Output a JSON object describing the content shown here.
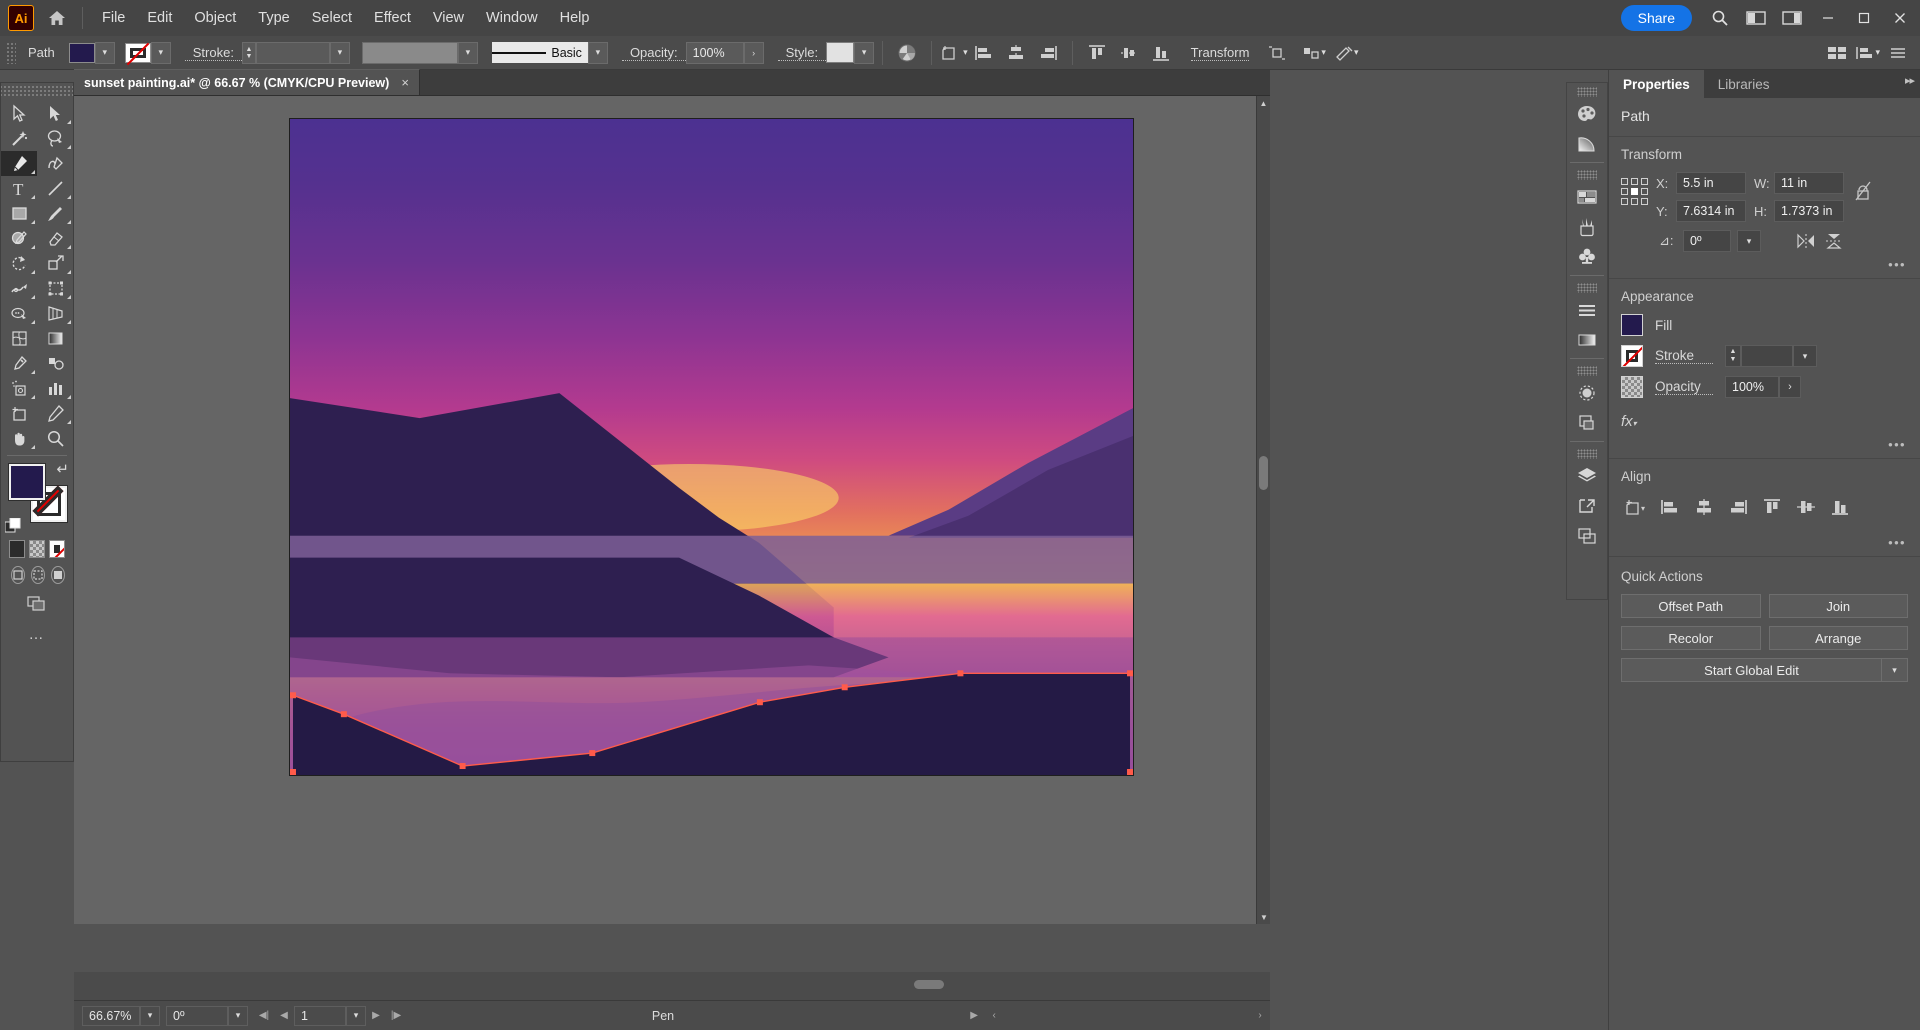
{
  "app": {
    "logo_text": "Ai",
    "menus": [
      "File",
      "Edit",
      "Object",
      "Type",
      "Select",
      "Effect",
      "View",
      "Window",
      "Help"
    ],
    "share_label": "Share",
    "accent_color": "#1473e6",
    "window_buttons": [
      "minimize",
      "maximize",
      "close"
    ]
  },
  "control_bar": {
    "object_label": "Path",
    "stroke_label": "Stroke:",
    "stroke_weight": "",
    "profile_value": "",
    "brush_label": "Basic",
    "opacity_label": "Opacity:",
    "opacity_value": "100%",
    "style_label": "Style:",
    "transform_label": "Transform",
    "fill_color": "#231a4d",
    "stroke_color": "none"
  },
  "toolbar": {
    "tools": [
      {
        "name": "selection-tool",
        "active": false
      },
      {
        "name": "direct-selection-tool",
        "active": false
      },
      {
        "name": "magic-wand-tool",
        "active": false
      },
      {
        "name": "lasso-tool",
        "active": false
      },
      {
        "name": "pen-tool",
        "active": true
      },
      {
        "name": "curvature-tool",
        "active": false
      },
      {
        "name": "type-tool",
        "active": false
      },
      {
        "name": "line-segment-tool",
        "active": false
      },
      {
        "name": "rectangle-tool",
        "active": false
      },
      {
        "name": "paintbrush-tool",
        "active": false
      },
      {
        "name": "shaper-tool",
        "active": false
      },
      {
        "name": "eraser-tool",
        "active": false
      },
      {
        "name": "rotate-tool",
        "active": false
      },
      {
        "name": "scale-tool",
        "active": false
      },
      {
        "name": "width-tool",
        "active": false
      },
      {
        "name": "free-transform-tool",
        "active": false
      },
      {
        "name": "shape-builder-tool",
        "active": false
      },
      {
        "name": "perspective-grid-tool",
        "active": false
      },
      {
        "name": "mesh-tool",
        "active": false
      },
      {
        "name": "gradient-tool",
        "active": false
      },
      {
        "name": "eyedropper-tool",
        "active": false
      },
      {
        "name": "blend-tool",
        "active": false
      },
      {
        "name": "symbol-sprayer-tool",
        "active": false
      },
      {
        "name": "column-graph-tool",
        "active": false
      },
      {
        "name": "artboard-tool",
        "active": false
      },
      {
        "name": "slice-tool",
        "active": false
      },
      {
        "name": "hand-tool",
        "active": false
      },
      {
        "name": "zoom-tool",
        "active": false
      }
    ],
    "fill_color": "#231a4d",
    "stroke_color": "none",
    "active_tool_name": "pen-tool"
  },
  "document": {
    "tab_title": "sunset painting.ai* @ 66.67 % (CMYK/CPU Preview)",
    "close_glyph": "×"
  },
  "status_bar": {
    "zoom_value": "66.67%",
    "rotation_value": "0º",
    "page_value": "1",
    "tool_name": "Pen"
  },
  "dock_rail": {
    "icons": [
      "color-panel-icon",
      "gradient-panel-icon",
      "swatches-panel-icon",
      "brushes-panel-icon",
      "symbols-panel-icon",
      "stroke-panel-icon",
      "gradient-bar-icon",
      "transparency-panel-icon",
      "pathfinder-panel-icon",
      "layers-panel-icon",
      "export-panel-icon",
      "artboards-panel-icon"
    ]
  },
  "properties": {
    "tabs": [
      {
        "label": "Properties",
        "active": true
      },
      {
        "label": "Libraries",
        "active": false
      }
    ],
    "object_type": "Path",
    "transform": {
      "title": "Transform",
      "x_label": "X:",
      "x_value": "5.5 in",
      "y_label": "Y:",
      "y_value": "7.6314 in",
      "w_label": "W:",
      "w_value": "11 in",
      "h_label": "H:",
      "h_value": "1.7373 in",
      "angle_label": "⊿:",
      "angle_value": "0º",
      "more_glyph": "•••"
    },
    "appearance": {
      "title": "Appearance",
      "fill_label": "Fill",
      "fill_color": "#231a4d",
      "stroke_label": "Stroke",
      "stroke_weight": "",
      "opacity_label": "Opacity",
      "opacity_value": "100%",
      "fx_label": "fx",
      "more_glyph": "•••"
    },
    "align": {
      "title": "Align",
      "buttons": [
        "align-to-selection-icon",
        "align-left-icon",
        "align-horizontal-center-icon",
        "align-right-icon",
        "align-top-icon",
        "align-vertical-center-icon",
        "align-bottom-icon"
      ],
      "more_glyph": "•••"
    },
    "quick_actions": {
      "title": "Quick Actions",
      "buttons": [
        "Offset Path",
        "Join",
        "Recolor",
        "Arrange"
      ],
      "global_edit_label": "Start Global Edit"
    }
  },
  "artwork": {
    "description": "sunset landscape with mountains, lake reflection and selected foreground path",
    "sky_gradient": [
      "#4c3191",
      "#8c3492",
      "#cf4b80",
      "#ec9352",
      "#f5cf3e"
    ],
    "mountain_dark": "#312053",
    "mountain_mid": "#4a3570",
    "water_band": "#7d5f96",
    "foreground_dark": "#241a45",
    "anchor_color": "#ff5b4a",
    "selected_path_anchors": 9
  }
}
